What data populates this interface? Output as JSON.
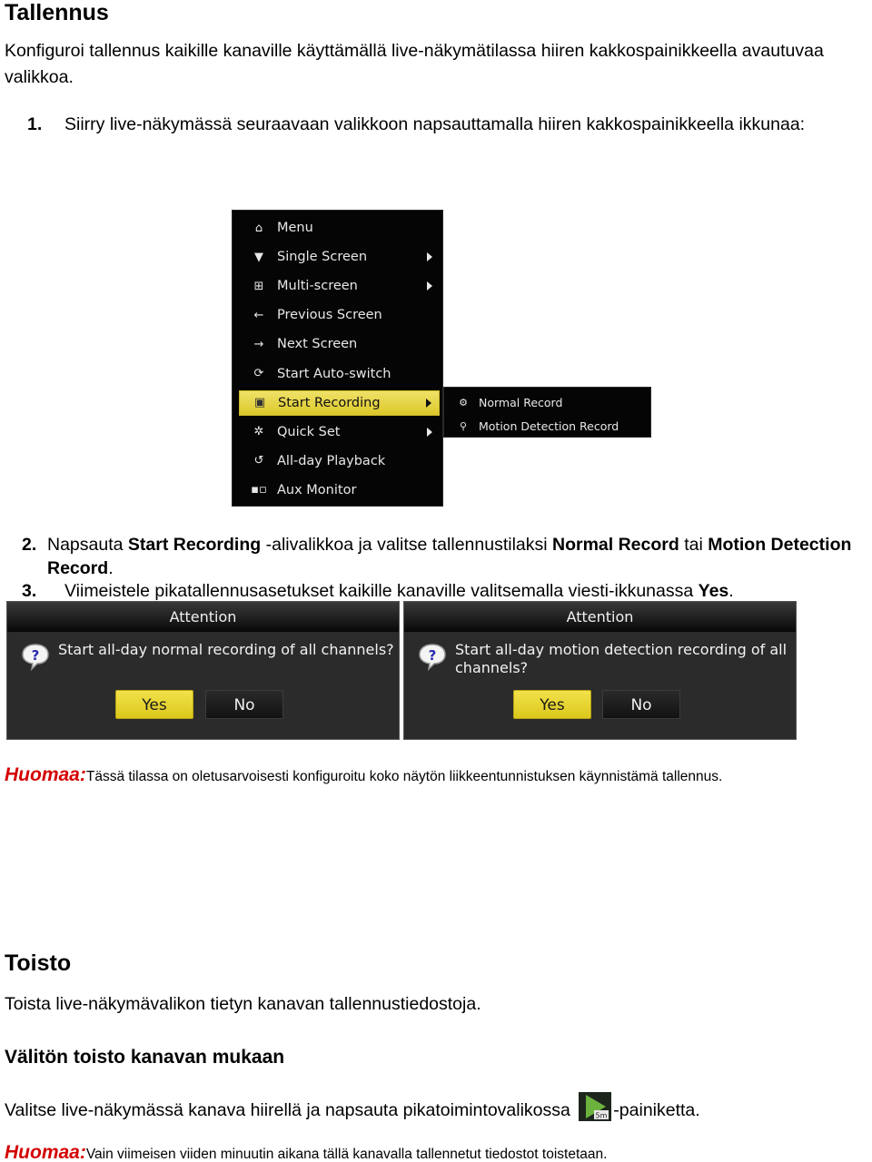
{
  "section1": {
    "title": "Tallennus",
    "intro": "Konfiguroi tallennus kaikille kanaville käyttämällä live-näkymätilassa hiiren kakkospainikkeella avautuvaa valikkoa.",
    "step1": {
      "num": "1.",
      "text": "Siirry live-näkymässä seuraavaan valikkoon napsauttamalla hiiren kakkospainikkeella ikkunaa:"
    },
    "step2": {
      "num": "2.",
      "t1": "Napsauta ",
      "b1": "Start Recording",
      "t2": " -alivalikkoa ja valitse tallennustilaksi  ",
      "b2": "Normal Record",
      "t3": " tai ",
      "b3": "Motion Detection Record",
      "t4": "."
    },
    "step3": {
      "num": "3.",
      "t1": "Viimeistele pikatallennusasetukset kaikille kanaville valitsemalla viesti-ikkunassa ",
      "b1": "Yes",
      "t2": "."
    },
    "note": {
      "label": "Huomaa:",
      "text": "Tässä tilassa on oletusarvoisesti konfiguroitu koko näytön liikkeentunnistuksen käynnistämä tallennus."
    }
  },
  "context_menu": {
    "items": [
      {
        "label": "Menu",
        "icon": "home-icon",
        "glyph": "⌂",
        "submenu": false
      },
      {
        "label": "Single Screen",
        "icon": "camera-icon",
        "glyph": "▼",
        "submenu": true
      },
      {
        "label": "Multi-screen",
        "icon": "multi-screen-icon",
        "glyph": "⊞",
        "submenu": true
      },
      {
        "label": "Previous Screen",
        "icon": "arrow-left-icon",
        "glyph": "←",
        "submenu": false
      },
      {
        "label": "Next Screen",
        "icon": "arrow-right-icon",
        "glyph": "→",
        "submenu": false
      },
      {
        "label": "Start Auto-switch",
        "icon": "refresh-icon",
        "glyph": "⟳",
        "submenu": false
      },
      {
        "label": "Start Recording",
        "icon": "record-camera-icon",
        "glyph": "▣",
        "submenu": true,
        "active": true
      },
      {
        "label": "Quick Set",
        "icon": "gear-icon",
        "glyph": "✲",
        "submenu": true
      },
      {
        "label": "All-day Playback",
        "icon": "playback-icon",
        "glyph": "↺",
        "submenu": false
      },
      {
        "label": "Aux Monitor",
        "icon": "aux-monitor-icon",
        "glyph": "▪▫",
        "submenu": false
      }
    ],
    "submenu": [
      {
        "label": "Normal Record",
        "icon": "normal-record-icon",
        "glyph": "⚙"
      },
      {
        "label": "Motion Detection Record",
        "icon": "motion-record-icon",
        "glyph": "⚲"
      }
    ]
  },
  "dialogs": [
    {
      "title": "Attention",
      "message": "Start all-day normal recording of all channels?",
      "yes": "Yes",
      "no": "No"
    },
    {
      "title": "Attention",
      "message": "Start all-day motion detection recording of all channels?",
      "yes": "Yes",
      "no": "No"
    }
  ],
  "section2": {
    "title": "Toisto",
    "intro": "Toista live-näkymävalikon tietyn kanavan tallennustiedostoja.",
    "subtitle": "Välitön toisto kanavan mukaan",
    "instr_before": "Valitse live-näkymässä kanava hiirellä ja napsauta pikatoimintovalikossa ",
    "instr_icon_label": "5m",
    "instr_after": "-painiketta.",
    "note": {
      "label": "Huomaa:",
      "text": "Vain viimeisen viiden minuutin aikana tällä kanavalla tallennetut tiedostot toistetaan."
    }
  },
  "colors": {
    "note_label": "#d40000",
    "highlight_yellow": "#e6d436",
    "menu_bg": "#050505",
    "dialog_bg": "#2b2b2b"
  }
}
